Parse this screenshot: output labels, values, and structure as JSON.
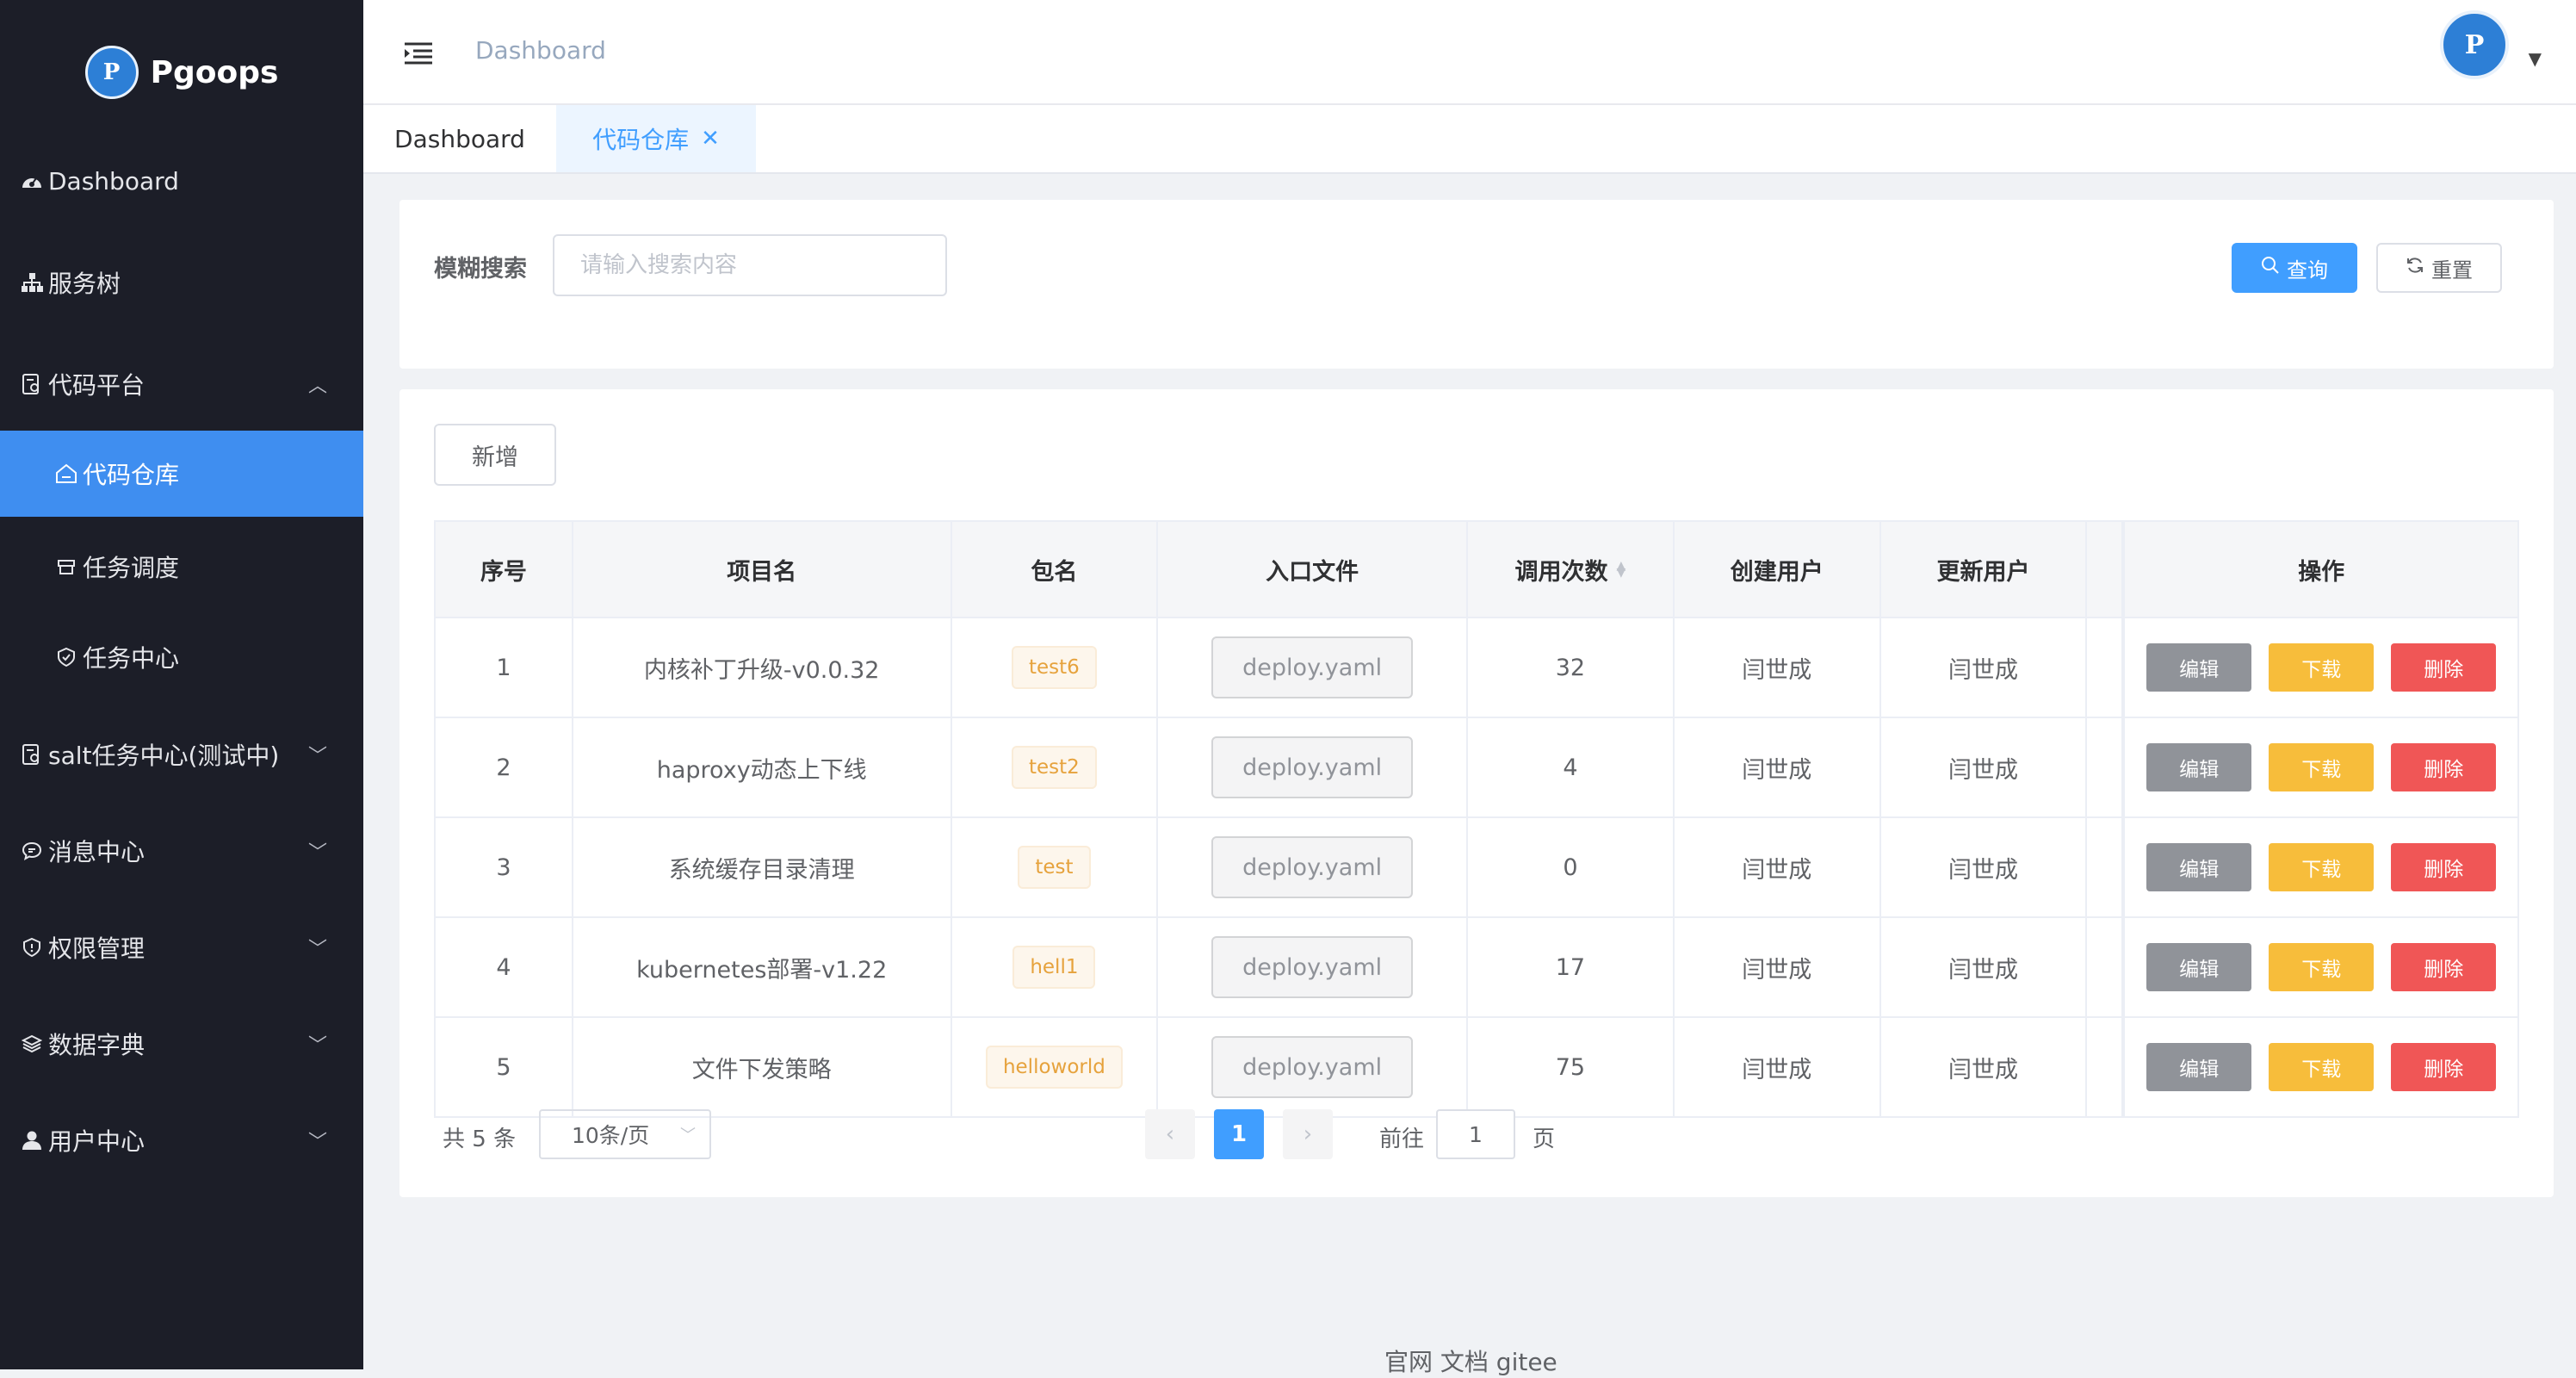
{
  "brand": {
    "name": "Pgoops",
    "logo_text": "P"
  },
  "sidebar": {
    "items": [
      {
        "label": "Dashboard",
        "icon": "dashboard-icon"
      },
      {
        "label": "服务树",
        "icon": "sitemap-icon"
      },
      {
        "label": "代码平台",
        "icon": "document-icon",
        "expanded": true
      },
      {
        "label": "代码仓库",
        "icon": "home-icon",
        "active": true
      },
      {
        "label": "任务调度",
        "icon": "box-icon"
      },
      {
        "label": "任务中心",
        "icon": "shield-check-icon"
      },
      {
        "label": "salt任务中心(测试中)",
        "icon": "document-icon"
      },
      {
        "label": "消息中心",
        "icon": "chat-icon"
      },
      {
        "label": "权限管理",
        "icon": "shield-icon"
      },
      {
        "label": "数据字典",
        "icon": "layers-icon"
      },
      {
        "label": "用户中心",
        "icon": "user-icon"
      }
    ]
  },
  "header": {
    "breadcrumb": "Dashboard"
  },
  "tabs": [
    {
      "label": "Dashboard",
      "active": false
    },
    {
      "label": "代码仓库",
      "active": true,
      "close": "✕"
    }
  ],
  "search": {
    "label": "模糊搜索",
    "placeholder": "请输入搜索内容",
    "value": "",
    "query_label": "查询",
    "reset_label": "重置"
  },
  "toolbar": {
    "add_label": "新增"
  },
  "table": {
    "headers": {
      "index": "序号",
      "name": "项目名",
      "package": "包名",
      "entry": "入口文件",
      "count": "调用次数",
      "creator": "创建用户",
      "updater": "更新用户",
      "ops": "操作"
    },
    "rows": [
      {
        "index": "1",
        "name": "内核补丁升级-v0.0.32",
        "package": "test6",
        "entry": "deploy.yaml",
        "count": "32",
        "creator": "闫世成",
        "updater": "闫世成"
      },
      {
        "index": "2",
        "name": "haproxy动态上下线",
        "package": "test2",
        "entry": "deploy.yaml",
        "count": "4",
        "creator": "闫世成",
        "updater": "闫世成"
      },
      {
        "index": "3",
        "name": "系统缓存目录清理",
        "package": "test",
        "entry": "deploy.yaml",
        "count": "0",
        "creator": "闫世成",
        "updater": "闫世成"
      },
      {
        "index": "4",
        "name": "kubernetes部署-v1.22",
        "package": "hell1",
        "entry": "deploy.yaml",
        "count": "17",
        "creator": "闫世成",
        "updater": "闫世成"
      },
      {
        "index": "5",
        "name": "文件下发策略",
        "package": "helloworld",
        "entry": "deploy.yaml",
        "count": "75",
        "creator": "闫世成",
        "updater": "闫世成"
      }
    ],
    "op_labels": {
      "edit": "编辑",
      "download": "下载",
      "delete": "删除"
    }
  },
  "pagination": {
    "total_text": "共 5 条",
    "page_size": "10条/页",
    "current_page": "1",
    "goto_prefix": "前往",
    "goto_value": "1",
    "goto_suffix": "页"
  },
  "footer": {
    "links": "官网 文档 gitee"
  },
  "colors": {
    "primary": "#409eff",
    "sidebar_bg": "#1c1e28",
    "active_menu": "#3f8ef0",
    "edit": "#909399",
    "download": "#f7bd3b",
    "delete": "#f05656"
  }
}
